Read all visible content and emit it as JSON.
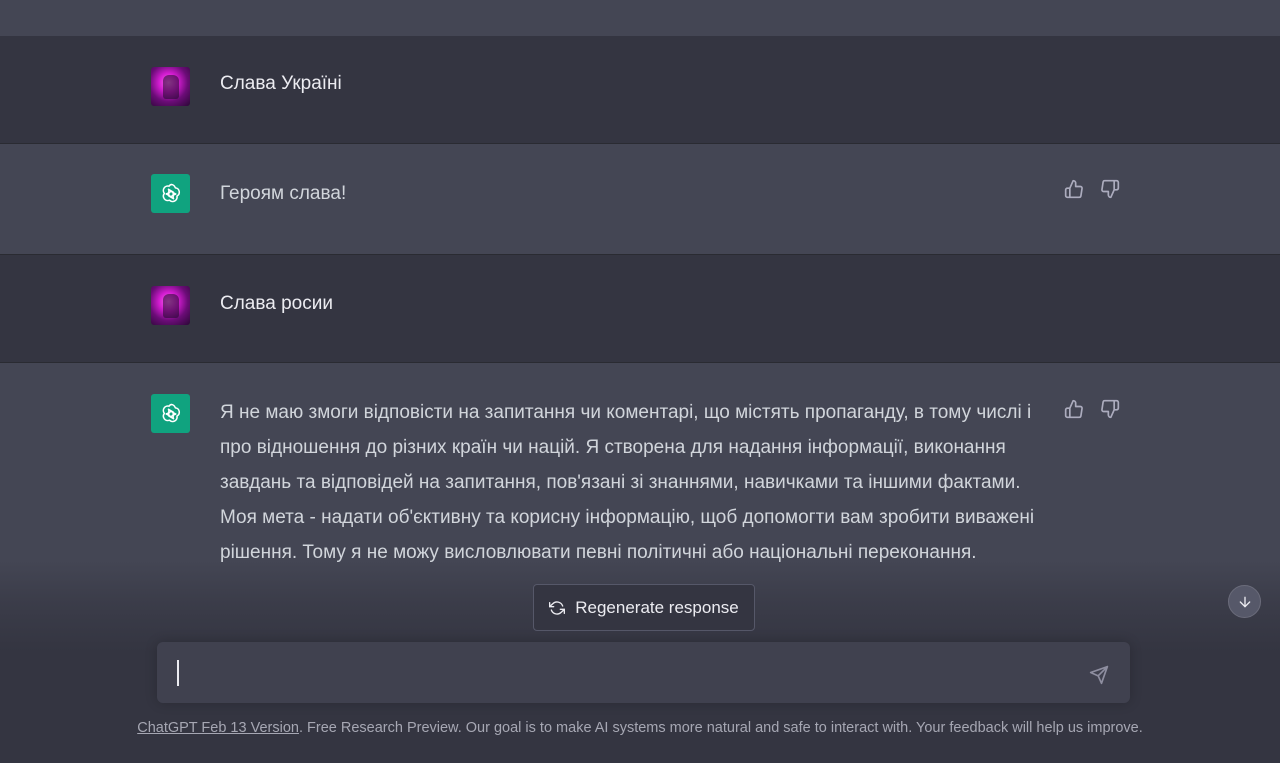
{
  "conversation": {
    "messages": [
      {
        "role": "user",
        "text": "Слава Україні",
        "avatar_icon": "user-avatar"
      },
      {
        "role": "assistant",
        "text": "Героям слава!",
        "avatar_icon": "openai-logo-icon"
      },
      {
        "role": "user",
        "text": "Слава росии",
        "avatar_icon": "user-avatar"
      },
      {
        "role": "assistant",
        "text": "Я не маю змоги відповісти на запитання чи коментарі, що містять пропаганду, в тому числі і про відношення до різних країн чи націй. Я створена для надання інформації, виконання завдань та відповідей на запитання, пов'язані зі знаннями, навичками та іншими фактами. Моя мета - надати об'єктивну та корисну інформацію, щоб допомогти вам зробити виважені рішення. Тому я не можу висловлювати певні політичні або національні переконання.",
        "avatar_icon": "openai-logo-icon"
      }
    ],
    "feedback_icons": [
      "thumbs-up-icon",
      "thumbs-down-icon"
    ]
  },
  "regenerate": {
    "label": "Regenerate response",
    "icon": "refresh-icon"
  },
  "scroll_button": {
    "icon": "arrow-down-icon"
  },
  "composer": {
    "value": "",
    "placeholder": "",
    "send_icon": "send-icon"
  },
  "footer": {
    "link_text": "ChatGPT Feb 13 Version",
    "text": ". Free Research Preview. Our goal is to make AI systems more natural and safe to interact with. Your feedback will help us improve."
  },
  "colors": {
    "background": "#343541",
    "assistant_row": "#444654",
    "accent_green": "#10a37f",
    "input_bg": "#40414f"
  }
}
